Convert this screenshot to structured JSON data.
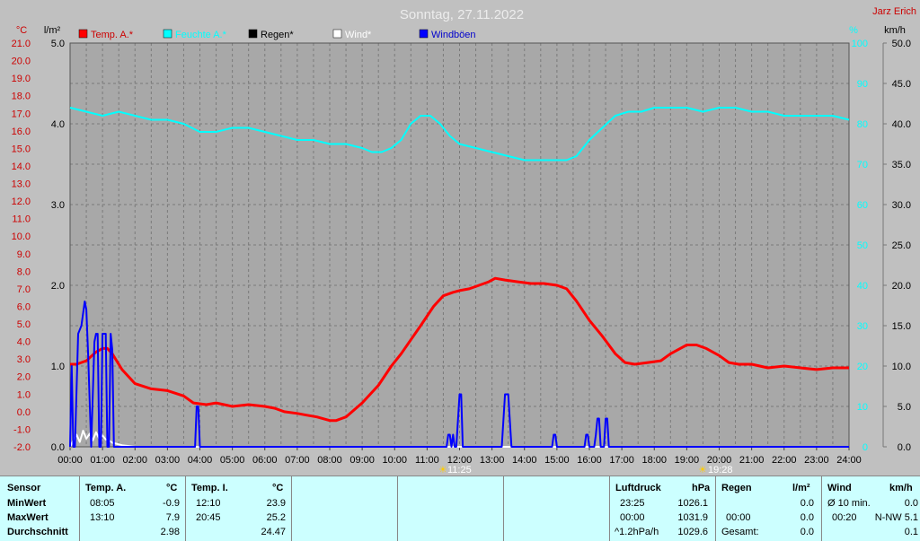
{
  "header": {
    "title": "Sonntag, 27.11.2022",
    "site": "Jarz Erich",
    "unit_temp": "°C",
    "unit_rain": "l/m²",
    "unit_hum": "%",
    "unit_wind": "km/h"
  },
  "legend": [
    {
      "label": "Temp. A.*",
      "color": "#ff0000"
    },
    {
      "label": "Feuchte A.*",
      "color": "#00ffff"
    },
    {
      "label": "Regen*",
      "color": "#000000"
    },
    {
      "label": "Wind*",
      "color": "#ffffff"
    },
    {
      "label": "Windböen",
      "color": "#0000ff"
    }
  ],
  "sun_markers": {
    "sunrise": "11:25",
    "sunset": "19:28"
  },
  "chart_data": {
    "type": "line",
    "grid": true,
    "x_ticks": [
      "00:00",
      "01:00",
      "02:00",
      "03:00",
      "04:00",
      "05:00",
      "06:00",
      "07:00",
      "08:00",
      "09:00",
      "10:00",
      "11:00",
      "12:00",
      "13:00",
      "14:00",
      "15:00",
      "16:00",
      "17:00",
      "18:00",
      "19:00",
      "20:00",
      "21:00",
      "22:00",
      "23:00",
      "24:00"
    ],
    "axes": {
      "temp": {
        "ylim": [
          -2.0,
          21.0
        ],
        "ticks": [
          "-2.0",
          "-1.0",
          "0.0",
          "1.0",
          "2.0",
          "3.0",
          "4.0",
          "5.0",
          "6.0",
          "7.0",
          "8.0",
          "9.0",
          "10.0",
          "11.0",
          "12.0",
          "13.0",
          "14.0",
          "15.0",
          "16.0",
          "17.0",
          "18.0",
          "19.0",
          "20.0",
          "21.0"
        ]
      },
      "rain": {
        "ylim": [
          0.0,
          5.0
        ],
        "ticks": [
          "0.0",
          "1.0",
          "2.0",
          "3.0",
          "4.0",
          "5.0"
        ]
      },
      "humidity": {
        "ylim": [
          0,
          100
        ],
        "ticks": [
          "0",
          "10",
          "20",
          "30",
          "40",
          "50",
          "60",
          "70",
          "80",
          "90",
          "100"
        ]
      },
      "wind": {
        "ylim": [
          0.0,
          50.0
        ],
        "ticks": [
          "0.0",
          "5.0",
          "10.0",
          "15.0",
          "20.0",
          "25.0",
          "30.0",
          "35.0",
          "40.0",
          "45.0",
          "50.0"
        ]
      }
    },
    "series": [
      {
        "name": "Temp. A.*",
        "axis": "temp",
        "color": "#ff0000",
        "x": [
          0,
          0.2,
          0.5,
          0.8,
          1.0,
          1.15,
          1.3,
          1.6,
          2.0,
          2.5,
          3.0,
          3.5,
          3.8,
          4.2,
          4.5,
          5.0,
          5.5,
          6.0,
          6.3,
          6.6,
          7.0,
          7.3,
          7.6,
          8.0,
          8.2,
          8.5,
          9.0,
          9.5,
          9.9,
          10.2,
          10.5,
          10.8,
          11.2,
          11.5,
          11.8,
          12.0,
          12.3,
          12.6,
          12.9,
          13.1,
          13.4,
          13.8,
          14.2,
          14.6,
          15.0,
          15.3,
          15.6,
          16.0,
          16.4,
          16.8,
          17.1,
          17.4,
          17.8,
          18.2,
          18.5,
          18.8,
          19.0,
          19.3,
          19.6,
          20.0,
          20.3,
          20.6,
          21.0,
          21.5,
          22.0,
          22.5,
          23.0,
          23.5,
          24.0
        ],
        "y": [
          2.7,
          2.7,
          2.9,
          3.4,
          3.6,
          3.6,
          3.3,
          2.4,
          1.6,
          1.3,
          1.2,
          0.9,
          0.5,
          0.4,
          0.5,
          0.3,
          0.4,
          0.3,
          0.2,
          0.0,
          -0.1,
          -0.2,
          -0.3,
          -0.5,
          -0.5,
          -0.3,
          0.5,
          1.5,
          2.6,
          3.3,
          4.1,
          4.9,
          6.0,
          6.6,
          6.8,
          6.9,
          7.0,
          7.2,
          7.4,
          7.6,
          7.5,
          7.4,
          7.3,
          7.3,
          7.2,
          7.0,
          6.3,
          5.2,
          4.3,
          3.3,
          2.8,
          2.7,
          2.8,
          2.9,
          3.3,
          3.6,
          3.8,
          3.8,
          3.6,
          3.2,
          2.8,
          2.7,
          2.7,
          2.5,
          2.6,
          2.5,
          2.4,
          2.5,
          2.5
        ]
      },
      {
        "name": "Feuchte A.*",
        "axis": "humidity",
        "color": "#00ffff",
        "x": [
          0,
          0.5,
          1.0,
          1.5,
          2.0,
          2.5,
          3.0,
          3.5,
          4.0,
          4.5,
          5.0,
          5.5,
          6.0,
          6.5,
          7.0,
          7.5,
          8.0,
          8.5,
          9.0,
          9.3,
          9.6,
          9.9,
          10.2,
          10.5,
          10.8,
          11.1,
          11.4,
          11.7,
          12.0,
          12.5,
          13.0,
          13.5,
          14.0,
          14.5,
          15.0,
          15.3,
          15.6,
          16.0,
          16.4,
          16.8,
          17.2,
          17.6,
          18.0,
          18.5,
          19.0,
          19.5,
          20.0,
          20.5,
          21.0,
          21.5,
          22.0,
          22.5,
          23.0,
          23.5,
          24.0
        ],
        "y": [
          84,
          83,
          82,
          83,
          82,
          81,
          81,
          80,
          78,
          78,
          79,
          79,
          78,
          77,
          76,
          76,
          75,
          75,
          74,
          73,
          73,
          74,
          76,
          80,
          82,
          82,
          80,
          77,
          75,
          74,
          73,
          72,
          71,
          71,
          71,
          71,
          72,
          76,
          79,
          82,
          83,
          83,
          84,
          84,
          84,
          83,
          84,
          84,
          83,
          83,
          82,
          82,
          82,
          82,
          81
        ]
      },
      {
        "name": "Wind*",
        "axis": "wind",
        "color": "#ffffff",
        "x": [
          0,
          0.1,
          0.2,
          0.3,
          0.4,
          0.5,
          0.6,
          0.7,
          0.8,
          0.9,
          1.0,
          1.1,
          1.2,
          1.3,
          1.4,
          1.6,
          1.8,
          2.0,
          24.0
        ],
        "y": [
          0.0,
          0.8,
          1.5,
          0.6,
          2.0,
          1.0,
          1.6,
          0.8,
          1.8,
          1.0,
          1.4,
          0.9,
          0.8,
          0.5,
          0.4,
          0.2,
          0.1,
          0.0,
          0.0
        ]
      },
      {
        "name": "Windböen",
        "axis": "wind",
        "color": "#0000ff",
        "x": [
          0,
          0.05,
          0.1,
          0.15,
          0.25,
          0.35,
          0.45,
          0.5,
          0.55,
          0.6,
          0.65,
          0.75,
          0.8,
          0.85,
          0.9,
          0.95,
          1.0,
          1.05,
          1.1,
          1.15,
          1.2,
          1.25,
          1.3,
          1.35,
          1.4,
          3.85,
          3.9,
          3.95,
          4.0,
          11.55,
          11.6,
          11.65,
          11.7,
          11.75,
          11.8,
          11.85,
          11.9,
          12.0,
          12.05,
          12.1,
          13.3,
          13.4,
          13.5,
          13.6,
          13.7,
          14.85,
          14.9,
          14.95,
          15.0,
          15.85,
          15.9,
          15.95,
          16.0,
          16.15,
          16.2,
          16.25,
          16.3,
          16.35,
          16.4,
          16.45,
          16.5,
          16.55,
          16.6,
          16.65,
          16.7,
          16.75,
          16.8,
          16.85,
          16.9,
          24.0
        ],
        "y": [
          0,
          10,
          0,
          0,
          14,
          15,
          18,
          17,
          12,
          6,
          0,
          13,
          14,
          14,
          0,
          0,
          14,
          14,
          14,
          0,
          0,
          14,
          12,
          0,
          0,
          0,
          5,
          5,
          0,
          0,
          0,
          1.5,
          1.5,
          0,
          1.5,
          0,
          0,
          6.5,
          6.5,
          0,
          0,
          6.5,
          6.5,
          0,
          0,
          0,
          1.5,
          1.5,
          0,
          0,
          1.5,
          1.5,
          0,
          0,
          1.5,
          3.5,
          3.5,
          0,
          0,
          0,
          3.5,
          3.5,
          0,
          0,
          0,
          0,
          0,
          0,
          0,
          0
        ]
      }
    ]
  },
  "stats": {
    "sensor": {
      "header": "Sensor",
      "rows": [
        "MinWert",
        "MaxWert",
        "Durchschnitt"
      ]
    },
    "temp_a": {
      "header": "Temp. A.",
      "unit": "°C",
      "min_time": "08:05",
      "min_val": "-0.9",
      "max_time": "13:10",
      "max_val": "7.9",
      "avg": "2.98"
    },
    "temp_i": {
      "header": "Temp. I.",
      "unit": "°C",
      "min_time": "12:10",
      "min_val": "23.9",
      "max_time": "20:45",
      "max_val": "25.2",
      "avg": "24.47"
    },
    "pressure": {
      "header": "Luftdruck",
      "unit": "hPa",
      "r1_time": "23:25",
      "r1_val": "1026.1",
      "r2_time": "00:00",
      "r2_val": "1031.9",
      "r3_time": "^1.2hPa/h",
      "r3_val": "1029.6"
    },
    "rain": {
      "header": "Regen",
      "unit": "l/m²",
      "r1_val": "0.0",
      "r2_time": "00:00",
      "r2_val": "0.0",
      "r3_label": "Gesamt:",
      "r3_val": "0.0"
    },
    "wind": {
      "header": "Wind",
      "unit": "km/h",
      "r1_label": "Ø 10 min.",
      "r1_val": "0.0",
      "r2_time": "00:20",
      "r2_val": "N-NW 5.1",
      "r3_val": "0.1"
    }
  }
}
